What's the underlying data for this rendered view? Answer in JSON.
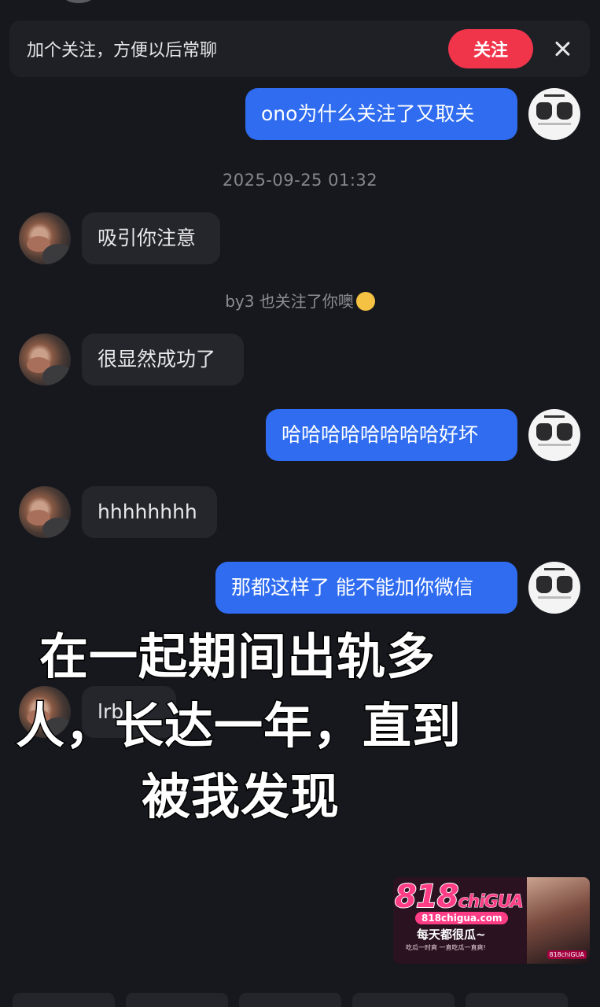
{
  "banner": {
    "text": "加个关注，方便以后常聊",
    "follow_label": "关注"
  },
  "messages": [
    {
      "from": "me",
      "text": "ono为什么关注了又取关"
    },
    {
      "from": "them",
      "text": "吸引你注意"
    },
    {
      "from": "them",
      "text": "很显然成功了"
    },
    {
      "from": "me",
      "text": "哈哈哈哈哈哈哈哈好坏"
    },
    {
      "from": "them",
      "text": "hhhhhhhh"
    },
    {
      "from": "me",
      "text": "那都这样了 能不能加你微信"
    },
    {
      "from": "them",
      "text": "lrb"
    }
  ],
  "timestamp": "2025-09-25 01:32",
  "system_notice": "by3 也关注了你噢",
  "overlay_caption": [
    "在一起期间出轨多",
    "人，长达一年，直到",
    "被我发现"
  ],
  "watermark": {
    "logo": "818",
    "logo_suffix": "chiGUA",
    "domain": "818chigua.com",
    "slogan": "每天都很瓜~",
    "sub": "吃瓜一时爽 一直吃瓜一直爽!",
    "tag": "818chiGUA"
  }
}
